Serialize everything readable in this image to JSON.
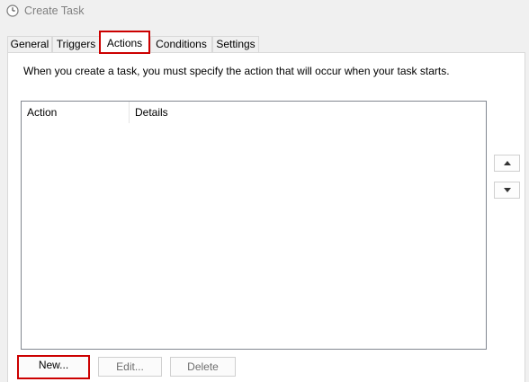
{
  "window": {
    "title": "Create Task"
  },
  "tabs": [
    {
      "label": "General",
      "active": false
    },
    {
      "label": "Triggers",
      "active": false
    },
    {
      "label": "Actions",
      "active": true
    },
    {
      "label": "Conditions",
      "active": false
    },
    {
      "label": "Settings",
      "active": false
    }
  ],
  "actions_page": {
    "description": "When you create a task, you must specify the action that will occur when your task starts.",
    "table": {
      "columns": [
        "Action",
        "Details"
      ],
      "rows": []
    },
    "move_up_icon": "triangle-up-icon",
    "move_down_icon": "triangle-down-icon",
    "buttons": {
      "new": "New...",
      "edit": "Edit...",
      "delete": "Delete"
    }
  },
  "colors": {
    "highlight": "#cc0000",
    "window_bg": "#f0f0f0",
    "title_text": "#808080",
    "disabled_text": "#6e6e6e"
  }
}
